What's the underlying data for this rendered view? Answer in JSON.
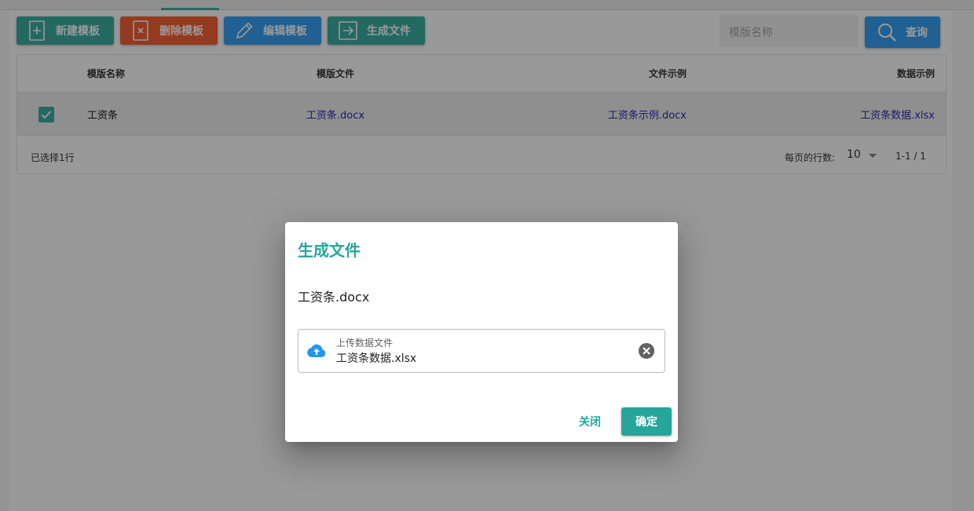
{
  "toolbar": {
    "new_label": "新建模板",
    "delete_label": "删除模板",
    "edit_label": "编辑模板",
    "generate_label": "生成文件",
    "search_placeholder": "模版名称",
    "search_button_label": "查询"
  },
  "table": {
    "headers": {
      "name": "模版名称",
      "template": "模版文件",
      "example": "文件示例",
      "data": "数据示例"
    },
    "rows": [
      {
        "checked": true,
        "name": "工资条",
        "template": "工资条.docx",
        "example": "工资条示例.docx",
        "data": "工资条数据.xlsx"
      }
    ],
    "footer": {
      "selected": "已选择1行",
      "rows_per_page_label": "每页的行数:",
      "rows_per_page": "10",
      "range": "1-1 / 1"
    }
  },
  "dialog": {
    "title": "生成文件",
    "template_file": "工资条.docx",
    "upload_label": "上传数据文件",
    "upload_value": "工资条数据.xlsx",
    "close_label": "关闭",
    "confirm_label": "确定"
  },
  "colors": {
    "teal": "#26a69a",
    "orange": "#f4511e",
    "blue": "#2196f3",
    "link": "#1a0dab"
  },
  "icons": [
    "add-file-icon",
    "delete-file-icon",
    "pencil-icon",
    "export-icon",
    "search-icon",
    "check-icon",
    "dropdown-arrow-icon",
    "cloud-upload-icon",
    "clear-circle-icon"
  ]
}
